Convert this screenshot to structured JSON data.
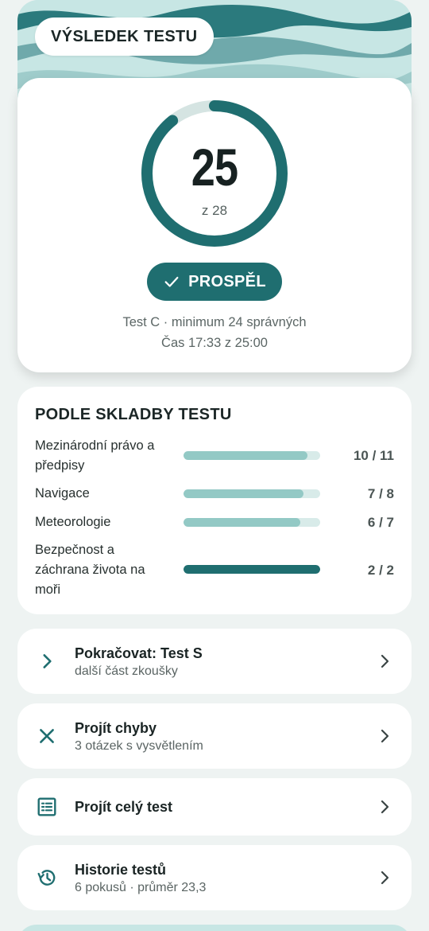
{
  "header": {
    "title": "VÝSLEDEK TESTU"
  },
  "result": {
    "score": "25",
    "total_label": "z 28",
    "correct": 25,
    "total": 28,
    "status": "PROSPĚL",
    "meta_test": "Test C · minimum 24 správných",
    "meta_time": "Čas 17:33 z 25:00"
  },
  "breakdown": {
    "title": "PODLE SKLADBY TESTU",
    "items": [
      {
        "label": "Mezinárodní právo a předpisy",
        "score": "10 / 11",
        "fraction": 0.909
      },
      {
        "label": "Navigace",
        "score": "7 / 8",
        "fraction": 0.875
      },
      {
        "label": "Meteorologie",
        "score": "6 / 7",
        "fraction": 0.857
      },
      {
        "label": "Bezpečnost a záchrana života na moři",
        "score": "2 / 2",
        "fraction": 1.0
      }
    ]
  },
  "actions": [
    {
      "title": "Pokračovat: Test S",
      "subtitle": "další část zkoušky",
      "icon": "chevron-right-icon"
    },
    {
      "title": "Projít chyby",
      "subtitle": "3 otázek s vysvětlením",
      "icon": "close-icon"
    },
    {
      "title": "Projít celý test",
      "subtitle": "",
      "icon": "list-icon"
    },
    {
      "title": "Historie testů",
      "subtitle": "6 pokusů · průměr 23,3",
      "icon": "history-icon"
    }
  ],
  "colors": {
    "accent": "#1f6e70",
    "accent_light": "#93c9c5",
    "track": "#d8ebe9",
    "background": "#eef3f2",
    "wave": "#c7e6e4"
  }
}
